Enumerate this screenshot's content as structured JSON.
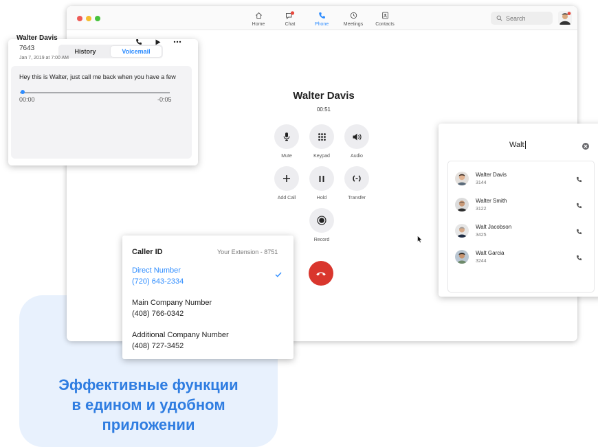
{
  "promo": {
    "line1": "Эффективные функции",
    "line2": "в едином и удобном",
    "line3": "приложении"
  },
  "topbar": {
    "nav": [
      {
        "label": "Home",
        "icon": "home-icon"
      },
      {
        "label": "Chat",
        "icon": "chat-icon"
      },
      {
        "label": "Phone",
        "icon": "phone-icon"
      },
      {
        "label": "Meetings",
        "icon": "clock-icon"
      },
      {
        "label": "Contacts",
        "icon": "contacts-icon"
      }
    ],
    "search_placeholder": "Search",
    "accent": "#2d8cff",
    "badge": "#e8473c"
  },
  "call": {
    "name": "Walter Davis",
    "timer": "00:51",
    "controls": [
      {
        "label": "Mute",
        "icon": "microphone-icon"
      },
      {
        "label": "Keypad",
        "icon": "keypad-icon"
      },
      {
        "label": "Audio",
        "icon": "speaker-icon"
      },
      {
        "label": "Add Call",
        "icon": "plus-icon"
      },
      {
        "label": "Hold",
        "icon": "pause-icon"
      },
      {
        "label": "Transfer",
        "icon": "transfer-icon"
      },
      {
        "label": "Record",
        "icon": "record-icon"
      }
    ],
    "end_icon": "hangup-icon",
    "end_color": "#d9362d"
  },
  "voicemail": {
    "tabs": [
      {
        "label": "History",
        "active": false
      },
      {
        "label": "Voicemail",
        "active": true
      }
    ],
    "name": "Walter Davis",
    "extension": "7643",
    "date": "Jan 7, 2019 at 7:00 AM",
    "message": "Hey this is Walter, just call me back when you have a few",
    "time_start": "00:00",
    "time_end": "-0:05",
    "progress": 0.02
  },
  "contact_search": {
    "query": "Walt",
    "results": [
      {
        "name": "Walter Davis",
        "ext": "3144"
      },
      {
        "name": "Walter Smith",
        "ext": "3122"
      },
      {
        "name": "Walt Jacobson",
        "ext": "3425"
      },
      {
        "name": "Walt Garcia",
        "ext": "3244"
      }
    ]
  },
  "caller_id": {
    "title": "Caller ID",
    "your_extension": "Your Extension - 8751",
    "options": [
      {
        "label": "Direct Number",
        "number": "(720) 643-2334",
        "selected": true
      },
      {
        "label": "Main Company Number",
        "number": "(408) 766-0342",
        "selected": false
      },
      {
        "label": "Additional Company Number",
        "number": "(408) 727-3452",
        "selected": false
      }
    ]
  }
}
